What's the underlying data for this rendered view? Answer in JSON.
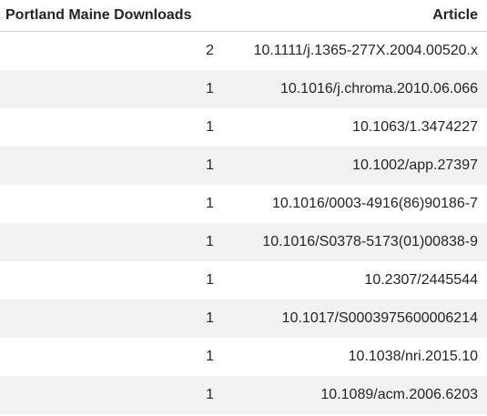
{
  "table": {
    "headers": {
      "downloads": "Portland Maine Downloads",
      "article": "Article"
    },
    "rows": [
      {
        "downloads": "2",
        "article": "10.1111/j.1365-277X.2004.00520.x"
      },
      {
        "downloads": "1",
        "article": "10.1016/j.chroma.2010.06.066"
      },
      {
        "downloads": "1",
        "article": "10.1063/1.3474227"
      },
      {
        "downloads": "1",
        "article": "10.1002/app.27397"
      },
      {
        "downloads": "1",
        "article": "10.1016/0003-4916(86)90186-7"
      },
      {
        "downloads": "1",
        "article": "10.1016/S0378-5173(01)00838-9"
      },
      {
        "downloads": "1",
        "article": "10.2307/2445544"
      },
      {
        "downloads": "1",
        "article": "10.1017/S0003975600006214"
      },
      {
        "downloads": "1",
        "article": "10.1038/nri.2015.10"
      },
      {
        "downloads": "1",
        "article": "10.1089/acm.2006.6203"
      }
    ]
  }
}
